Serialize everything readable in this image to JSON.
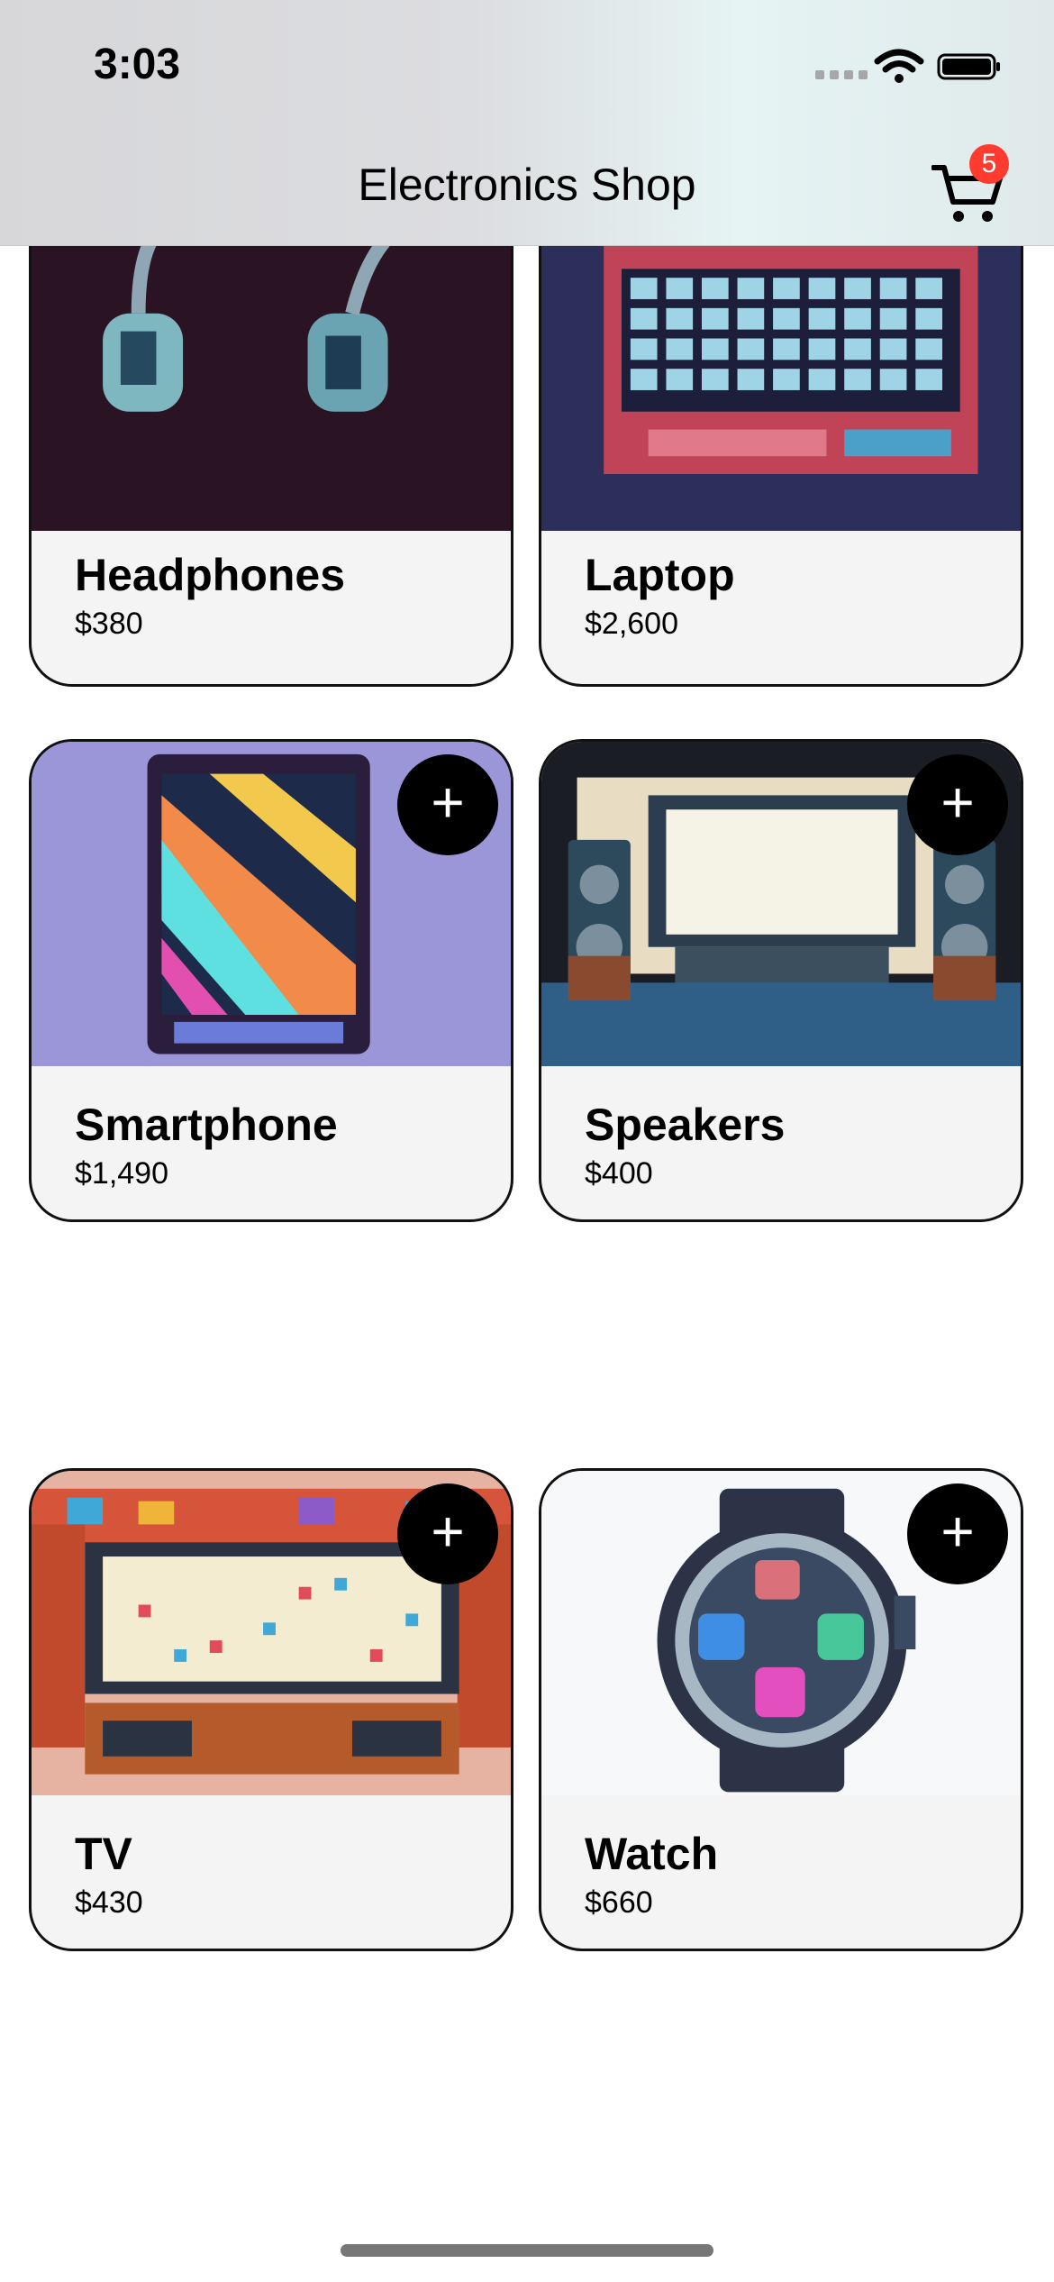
{
  "status_bar": {
    "time": "3:03"
  },
  "nav": {
    "title": "Electronics Shop",
    "cart_badge": "5",
    "cart_icon": "cart-icon"
  },
  "add_button_glyph": "+",
  "products": [
    {
      "name": "Headphones",
      "price": "$380",
      "image_bg": "#2a1323",
      "add_visible": false
    },
    {
      "name": "Laptop",
      "price": "$2,600",
      "image_bg": "#2b2f5a",
      "add_visible": false
    },
    {
      "name": "Smartphone",
      "price": "$1,490",
      "image_bg": "#9b96d8",
      "add_visible": true
    },
    {
      "name": "Speakers",
      "price": "$400",
      "image_bg": "#1b1d24",
      "add_visible": true
    },
    {
      "name": "TV",
      "price": "$430",
      "image_bg": "#e6b3a3",
      "add_visible": true
    },
    {
      "name": "Watch",
      "price": "$660",
      "image_bg": "#f6f8fa",
      "add_visible": true
    }
  ]
}
